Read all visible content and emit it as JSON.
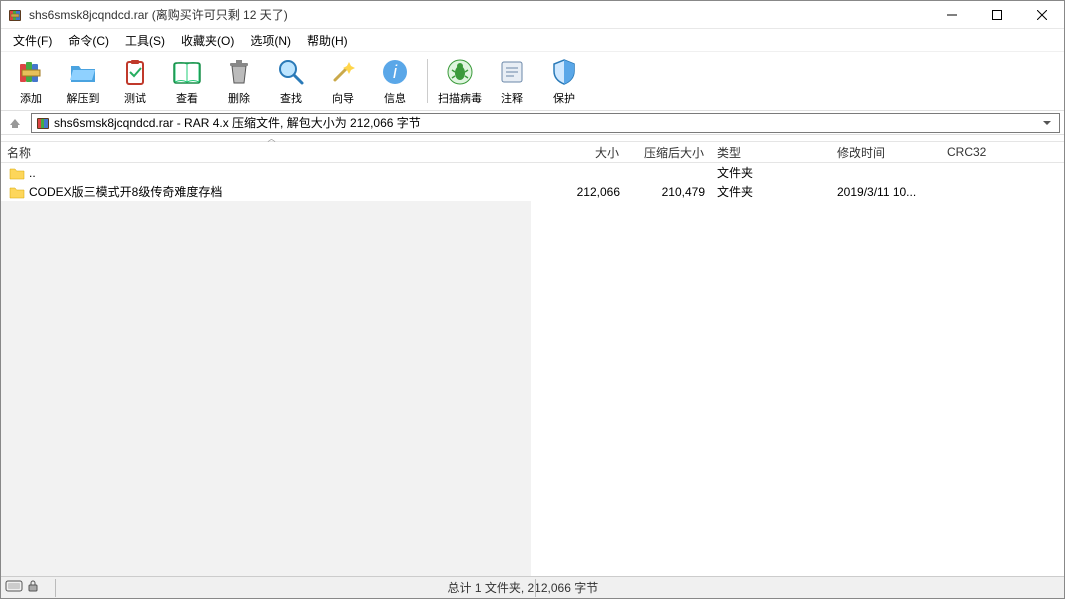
{
  "title": {
    "filename": "shs6smsk8jcqndcd.rar",
    "suffix": " (离购买许可只剩 12 天了)"
  },
  "menu": {
    "file": "文件(F)",
    "cmd": "命令(C)",
    "tool": "工具(S)",
    "fav": "收藏夹(O)",
    "opt": "选项(N)",
    "help": "帮助(H)"
  },
  "toolbar": {
    "add": "添加",
    "extract": "解压到",
    "test": "测试",
    "view": "查看",
    "delete": "删除",
    "find": "查找",
    "wizard": "向导",
    "info": "信息",
    "scan": "扫描病毒",
    "comment": "注释",
    "protect": "保护"
  },
  "address": "shs6smsk8jcqndcd.rar - RAR 4.x 压缩文件, 解包大小为 212,066 字节",
  "columns": {
    "name": "名称",
    "size": "大小",
    "packed": "压缩后大小",
    "type": "类型",
    "date": "修改时间",
    "crc": "CRC32"
  },
  "rows": [
    {
      "name": "..",
      "size": "",
      "packed": "",
      "type": "文件夹",
      "date": "",
      "crc": ""
    },
    {
      "name": "CODEX版三模式开8级传奇难度存档",
      "size": "212,066",
      "packed": "210,479",
      "type": "文件夹",
      "date": "2019/3/11 10...",
      "crc": ""
    }
  ],
  "status": "总计 1 文件夹, 212,066 字节"
}
